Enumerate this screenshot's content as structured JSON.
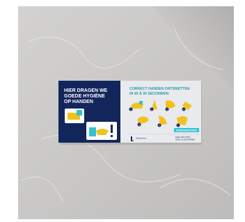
{
  "poster": {
    "left_headline": [
      "HIER DRAGEN WE",
      "GOEDE HYGIËNE",
      "OP HANDEN"
    ],
    "right_headline": [
      "CORRECT HANDEN ONTSMETTEN",
      "IN 20 À 30 SECONDEN:"
    ],
    "step_numbers": [
      "1",
      "2",
      "3",
      "4",
      "5",
      "6",
      "7"
    ],
    "cta_button": "STANDAARDTEKST",
    "footer_brand": "Vlaanderen",
    "footer_right": [
      "DOET HET VOOR",
      "ZORG & GEZONDHEID"
    ]
  },
  "colors": {
    "navy": "#13265c",
    "teal": "#2a98a6",
    "cyan": "#35c1d3",
    "yellow": "#f2c21b",
    "poster_bg": "#e8eaee",
    "wall": "#c9c8c6"
  }
}
